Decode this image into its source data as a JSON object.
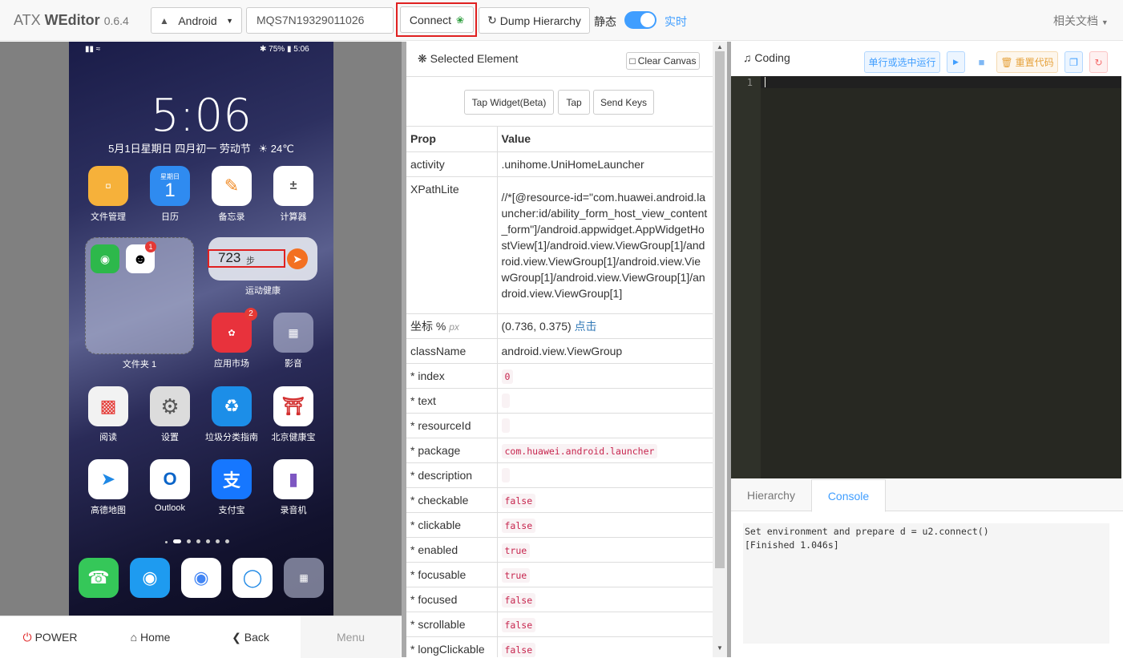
{
  "header": {
    "brand_prefix": "ATX ",
    "brand_name": "WEditor",
    "version": "0.6.4",
    "platform": "Android",
    "serial": "MQS7N19329011026",
    "connect_label": "Connect",
    "dump_label": "Dump Hierarchy",
    "static_label": "静态",
    "realtime_label": "实时",
    "docs_label": "相关文档"
  },
  "phone": {
    "time": "5:06",
    "date": "5月1日星期日 四月初一 劳动节",
    "weather": "24℃",
    "battery": "75%",
    "status_time": "5:06",
    "calendar_day": "星期日",
    "calendar_num": "1",
    "steps": "723",
    "steps_unit": "步",
    "apps_row1": [
      "文件管理",
      "日历",
      "备忘录",
      "计算器"
    ],
    "folder_label": "文件夹 1",
    "widget_label": "运动健康",
    "appmarket_label": "应用市场",
    "video_label": "影音",
    "apps_row3": [
      "阅读",
      "设置",
      "垃圾分类指南",
      "北京健康宝"
    ],
    "apps_row4": [
      "高德地图",
      "Outlook",
      "支付宝",
      "录音机"
    ],
    "badge_qq": "1",
    "badge_market": "2"
  },
  "nav": {
    "power": "POWER",
    "home": "Home",
    "back": "Back",
    "menu": "Menu"
  },
  "selected": {
    "title": "Selected Element",
    "clear_canvas": "Clear Canvas",
    "tap_widget": "Tap Widget(Beta)",
    "tap": "Tap",
    "send_keys": "Send Keys",
    "prop_header": "Prop",
    "value_header": "Value",
    "rows": {
      "activity_k": "activity",
      "activity_v": ".unihome.UniHomeLauncher",
      "xpath_k": "XPathLite",
      "xpath_v": "//*[@resource-id=\"com.huawei.android.launcher:id/ability_form_host_view_content_form\"]/android.appwidget.AppWidgetHostView[1]/android.view.ViewGroup[1]/android.view.ViewGroup[1]/android.view.ViewGroup[1]/android.view.ViewGroup[1]/android.view.ViewGroup[1]",
      "coord_k": "坐标 %",
      "coord_px": "px",
      "coord_v": "(0.736, 0.375)",
      "coord_link": "点击",
      "class_k": "className",
      "class_v": "android.view.ViewGroup",
      "index_k": "* index",
      "index_v": "0",
      "text_k": "* text",
      "rid_k": "* resourceId",
      "pkg_k": "* package",
      "pkg_v": "com.huawei.android.launcher",
      "desc_k": "* description",
      "checkable_k": "* checkable",
      "checkable_v": "false",
      "clickable_k": "* clickable",
      "clickable_v": "false",
      "enabled_k": "* enabled",
      "enabled_v": "true",
      "focusable_k": "* focusable",
      "focusable_v": "true",
      "focused_k": "* focused",
      "focused_v": "false",
      "scrollable_k": "* scrollable",
      "scrollable_v": "false",
      "longclick_k": "* longClickable",
      "longclick_v": "false"
    }
  },
  "coding": {
    "title": "Coding",
    "run_selected": "单行或选中运行",
    "reset_code": "重置代码",
    "line_no": "1",
    "tab_hierarchy": "Hierarchy",
    "tab_console": "Console",
    "console_line1": "Set environment and prepare d = u2.connect()",
    "console_line2": "[Finished 1.046s]"
  }
}
